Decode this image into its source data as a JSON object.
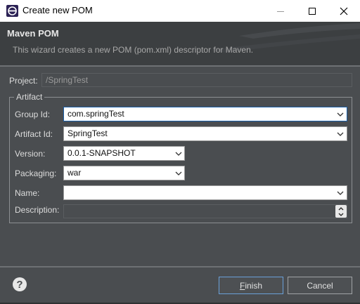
{
  "window": {
    "title": "Create new POM",
    "icons": {
      "app": "eclipse-icon",
      "minimize": "minimize-icon",
      "maximize": "maximize-icon",
      "close": "close-icon"
    }
  },
  "banner": {
    "title": "Maven POM",
    "message": "This wizard creates a new POM (pom.xml) descriptor for Maven."
  },
  "project": {
    "label": "Project:",
    "value": "/SpringTest"
  },
  "artifact": {
    "legend": "Artifact",
    "group_id": {
      "label": "Group Id:",
      "value": "com.springTest"
    },
    "artifact_id": {
      "label": "Artifact Id:",
      "value": "SpringTest"
    },
    "version": {
      "label": "Version:",
      "value": "0.0.1-SNAPSHOT"
    },
    "packaging": {
      "label": "Packaging:",
      "value": "war"
    },
    "name": {
      "label": "Name:",
      "value": ""
    },
    "description": {
      "label": "Description:",
      "value": ""
    }
  },
  "footer": {
    "help_icon": "help-icon",
    "help_glyph": "?",
    "finish_first": "F",
    "finish_rest": "inish",
    "cancel": "Cancel"
  },
  "colors": {
    "dialog_bg": "#4a4d50",
    "banner_bg": "#3c3f41",
    "focus_border": "#1a5fa8",
    "default_button_border": "#6aa0d8"
  }
}
